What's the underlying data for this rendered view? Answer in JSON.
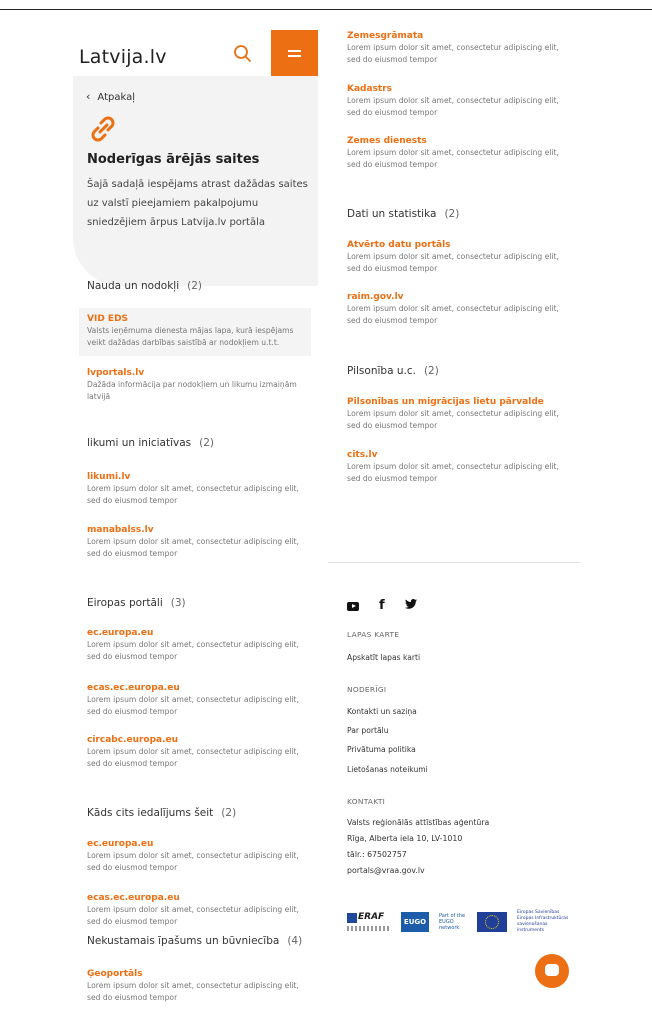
{
  "header": {
    "logo_text": "Latvija.lv",
    "search_icon": "search-icon",
    "menu_icon": "menu-icon"
  },
  "hero": {
    "back_label": "Atpakaļ",
    "title": "Noderīgas ārējās saites",
    "description": "Šajā sadaļā iespējams atrast dažādas saites uz valstī pieejamiem pakalpojumu sniedzējiem ārpus Latvija.lv portāla"
  },
  "left": {
    "cat1": {
      "title": "Nauda un nodokļi",
      "count": "(2)",
      "items": [
        {
          "title": "VID EDS",
          "desc": "Valsts ieņēmuma dienesta mājas lapa, kurā iespējams veikt dažādas darbības saistībā ar nodokļiem u.t.t."
        },
        {
          "title": "lvportals.lv",
          "desc": "Dažāda informācija par nodokļiem un likumu izmaiņām latvijā"
        }
      ]
    },
    "cat2": {
      "title": "likumi un iniciatīvas",
      "count": "(2)",
      "items": [
        {
          "title": "likumi.lv",
          "desc": "Lorem ipsum dolor sit amet, consectetur adipiscing elit, sed do eiusmod tempor"
        },
        {
          "title": "manabalss.lv",
          "desc": "Lorem ipsum dolor sit amet, consectetur adipiscing elit, sed do eiusmod tempor"
        }
      ]
    },
    "cat3": {
      "title": "Eiropas portāli",
      "count": "(3)",
      "items": [
        {
          "title": "ec.europa.eu",
          "desc": "Lorem ipsum dolor sit amet, consectetur adipiscing elit, sed do eiusmod tempor"
        },
        {
          "title": "ecas.ec.europa.eu",
          "desc": "Lorem ipsum dolor sit amet, consectetur adipiscing elit, sed do eiusmod tempor"
        },
        {
          "title": "circabc.europa.eu",
          "desc": "Lorem ipsum dolor sit amet, consectetur adipiscing elit, sed do eiusmod tempor"
        }
      ]
    },
    "cat4": {
      "title": "Kāds cits iedalījums šeit",
      "count": "(2)",
      "items": [
        {
          "title": "ec.europa.eu",
          "desc": "Lorem ipsum dolor sit amet, consectetur adipiscing elit, sed do eiusmod tempor"
        },
        {
          "title": "ecas.ec.europa.eu",
          "desc": "Lorem ipsum dolor sit amet, consectetur adipiscing elit, sed do eiusmod tempor"
        }
      ]
    },
    "cat5": {
      "title": "Nekustamais īpašums un būvniecība",
      "count": "(4)",
      "items": [
        {
          "title": "Ģeoportāls",
          "desc": "Lorem ipsum dolor sit amet, consectetur adipiscing elit, sed do eiusmod tempor"
        }
      ]
    }
  },
  "right": {
    "top_items": [
      {
        "title": "Zemesgrāmata",
        "desc": "Lorem ipsum dolor sit amet, consectetur adipiscing elit, sed do eiusmod tempor"
      },
      {
        "title": "Kadastrs",
        "desc": "Lorem ipsum dolor sit amet, consectetur adipiscing elit, sed do eiusmod tempor"
      },
      {
        "title": "Zemes dienests",
        "desc": "Lorem ipsum dolor sit amet, consectetur adipiscing elit, sed do eiusmod tempor"
      }
    ],
    "cat6": {
      "title": "Dati un statistika",
      "count": "(2)",
      "items": [
        {
          "title": "Atvērto datu portāls",
          "desc": "Lorem ipsum dolor sit amet, consectetur adipiscing elit, sed do eiusmod tempor"
        },
        {
          "title": "raim.gov.lv",
          "desc": "Lorem ipsum dolor sit amet, consectetur adipiscing elit, sed do eiusmod tempor"
        }
      ]
    },
    "cat7": {
      "title": "Pilsonība u.c.",
      "count": "(2)",
      "items": [
        {
          "title": "Pilsonības un migrācijas lietu pārvalde",
          "desc": "Lorem ipsum dolor sit amet, consectetur adipiscing elit, sed do eiusmod tempor"
        },
        {
          "title": "cits.lv",
          "desc": "Lorem ipsum dolor sit amet, consectetur adipiscing elit, sed do eiusmod tempor"
        }
      ]
    }
  },
  "footer": {
    "social": [
      "youtube-icon",
      "facebook-icon",
      "twitter-icon"
    ],
    "facebook_glyph": "f",
    "sitemap_heading": "LAPAS KARTE",
    "sitemap_link": "Apskatīt lapas karti",
    "useful_heading": "NODERĪGI",
    "useful_links": [
      "Kontakti un saziņa",
      "Par portālu",
      "Privātuma politika",
      "Lietošanas noteikumi"
    ],
    "contacts_heading": "KONTAKTI",
    "contacts": [
      "Valsts reģionālās attīstības aģentūra",
      "Rīga, Alberta iela 10, LV-1010",
      "tālr.: 67502757",
      "portals@vraa.gov.lv"
    ],
    "logos": {
      "eraf": "ERAF",
      "eugo": "EUGO",
      "eugo_text": "Part of the EUGO network",
      "eu_text": "Eiropas Savienības Eiropas Infrastruktūras savienošanas instruments"
    }
  },
  "colors": {
    "accent": "#ec6f14",
    "panel": "#f3f3f3"
  }
}
